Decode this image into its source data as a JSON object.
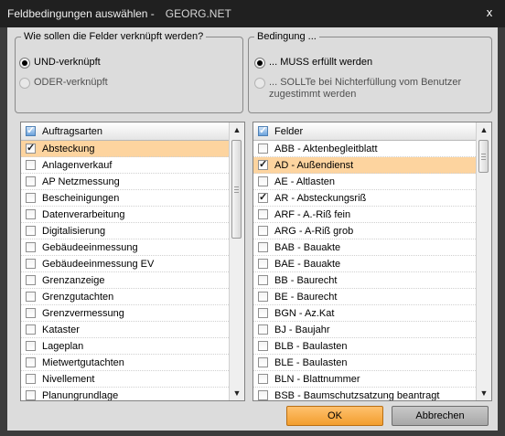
{
  "window": {
    "title": "Feldbedingungen auswählen -",
    "app_name": "GEORG.NET",
    "close_glyph": "x"
  },
  "link_group": {
    "legend": "Wie sollen die Felder verknüpft werden?",
    "options": [
      {
        "label": "UND-verknüpft",
        "checked": true
      },
      {
        "label": "ODER-verknüpft",
        "checked": false
      }
    ]
  },
  "condition_group": {
    "legend": "Bedingung ...",
    "options": [
      {
        "label": "... MUSS erfüllt werden",
        "checked": true
      },
      {
        "label": "... SOLLTe bei Nichterfüllung vom Benutzer zugestimmt werden",
        "checked": false
      }
    ]
  },
  "left_list": {
    "header": "Auftragsarten",
    "header_checked": true,
    "items": [
      {
        "label": "Absteckung",
        "checked": true,
        "selected": true
      },
      {
        "label": "Anlagenverkauf",
        "checked": false
      },
      {
        "label": "AP Netzmessung",
        "checked": false
      },
      {
        "label": "Bescheinigungen",
        "checked": false
      },
      {
        "label": "Datenverarbeitung",
        "checked": false
      },
      {
        "label": "Digitalisierung",
        "checked": false
      },
      {
        "label": "Gebäudeeinmessung",
        "checked": false
      },
      {
        "label": "Gebäudeeinmessung EV",
        "checked": false
      },
      {
        "label": "Grenzanzeige",
        "checked": false
      },
      {
        "label": "Grenzgutachten",
        "checked": false
      },
      {
        "label": "Grenzvermessung",
        "checked": false
      },
      {
        "label": "Kataster",
        "checked": false
      },
      {
        "label": "Lageplan",
        "checked": false
      },
      {
        "label": "Mietwertgutachten",
        "checked": false
      },
      {
        "label": "Nivellement",
        "checked": false
      },
      {
        "label": "Planungrundlage",
        "checked": false
      }
    ]
  },
  "right_list": {
    "header": "Felder",
    "header_checked": true,
    "items": [
      {
        "label": "ABB - Aktenbegleitblatt",
        "checked": false
      },
      {
        "label": "AD - Außendienst",
        "checked": true,
        "selected": true
      },
      {
        "label": "AE - Altlasten",
        "checked": false
      },
      {
        "label": "AR - Absteckungsriß",
        "checked": true
      },
      {
        "label": "ARF - A.-Riß fein",
        "checked": false
      },
      {
        "label": "ARG - A-Riß grob",
        "checked": false
      },
      {
        "label": "BAB - Bauakte",
        "checked": false
      },
      {
        "label": "BAE - Bauakte",
        "checked": false
      },
      {
        "label": "BB - Baurecht",
        "checked": false
      },
      {
        "label": "BE - Baurecht",
        "checked": false
      },
      {
        "label": "BGN - Az.Kat",
        "checked": false
      },
      {
        "label": "BJ - Baujahr",
        "checked": false
      },
      {
        "label": "BLB - Baulasten",
        "checked": false
      },
      {
        "label": "BLE - Baulasten",
        "checked": false
      },
      {
        "label": "BLN - Blattnummer",
        "checked": false
      },
      {
        "label": "BSB - Baumschutzsatzung beantragt",
        "checked": false
      }
    ]
  },
  "buttons": {
    "ok": "OK",
    "cancel": "Abbrechen"
  },
  "scroll_glyphs": {
    "up": "▲",
    "down": "▼"
  }
}
